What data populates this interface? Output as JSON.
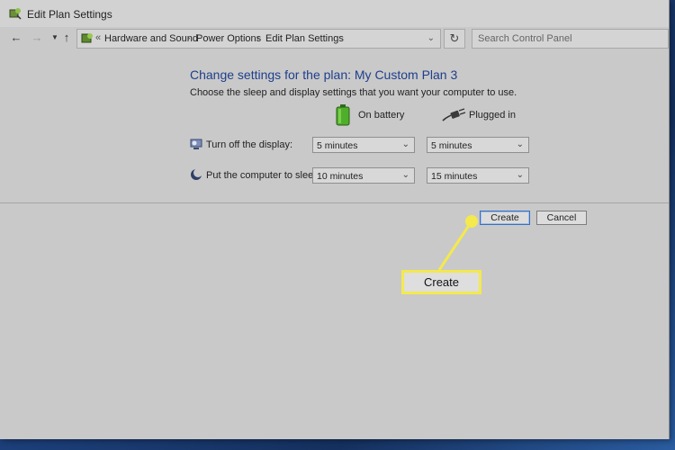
{
  "window": {
    "title": "Edit Plan Settings"
  },
  "nav": {
    "back_icon": "back-arrow-icon",
    "forward_icon": "forward-arrow-icon",
    "recent_icon": "chevron-down-icon",
    "up_icon": "up-arrow-icon",
    "breadcrumb": [
      "Hardware and Sound",
      "Power Options",
      "Edit Plan Settings"
    ],
    "overflow": "«",
    "refresh_icon": "refresh-icon",
    "search_placeholder": "Search Control Panel"
  },
  "plan": {
    "heading": "Change settings for the plan: My Custom Plan 3",
    "subheading": "Choose the sleep and display settings that you want your computer to use.",
    "columns": {
      "battery": "On battery",
      "plugged": "Plugged in"
    },
    "rows": [
      {
        "label": "Turn off the display:",
        "battery": "5 minutes",
        "plugged": "5 minutes"
      },
      {
        "label": "Put the computer to sleep:",
        "battery": "10 minutes",
        "plugged": "15 minutes"
      }
    ]
  },
  "buttons": {
    "create": "Create",
    "cancel": "Cancel"
  },
  "callout": {
    "label": "Create",
    "color": "#f4e94d"
  }
}
